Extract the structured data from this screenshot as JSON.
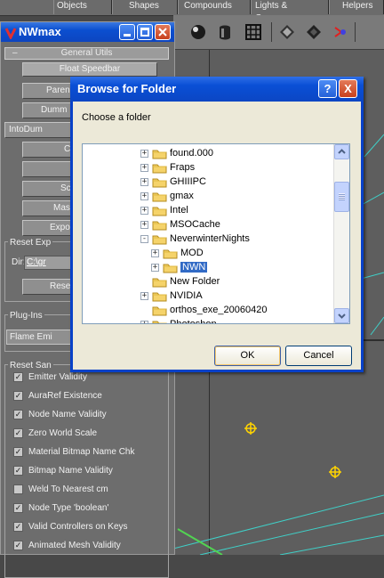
{
  "top_tabs": [
    "Objects",
    "Shapes",
    "Compounds",
    "Lights & Cameras",
    "Helpers"
  ],
  "toolbar_icons": [
    "sphere-icon",
    "cylinder-icon",
    "grid-icon",
    "diamond-icon",
    "diamond-filled-icon",
    "bone-icon"
  ],
  "nwmax": {
    "title": "NWmax",
    "rollout_general": "General Utils",
    "float_speedbar": "Float Speedbar",
    "buttons": [
      "Paren",
      "Dumm",
      "IntoDum",
      "C",
      "",
      "Sc",
      "Mas",
      "Expor"
    ],
    "reset_exp_label": "Reset Exp",
    "dir_label": "Dir:",
    "dir_value": "C:\\gr",
    "reset_button": "Reset",
    "plugins_label": "Plug-Ins",
    "plugin_value": "Flame Emi",
    "reset_san_label": "Reset San",
    "checks": [
      {
        "label": "Emitter Validity",
        "checked": true
      },
      {
        "label": "AuraRef Existence",
        "checked": true
      },
      {
        "label": "Node Name Validity",
        "checked": true
      },
      {
        "label": "Zero World Scale",
        "checked": true
      },
      {
        "label": "Material Bitmap Name Chk",
        "checked": true
      },
      {
        "label": "Bitmap Name Validity",
        "checked": true
      },
      {
        "label": "Weld To Nearest cm",
        "checked": false
      },
      {
        "label": "Node Type 'boolean'",
        "checked": true
      },
      {
        "label": "Valid Controllers on Keys",
        "checked": true
      },
      {
        "label": "Animated Mesh Validity",
        "checked": true
      }
    ]
  },
  "dialog": {
    "title": "Browse for Folder",
    "help": "?",
    "close": "X",
    "prompt": "Choose a folder",
    "tree": [
      {
        "label": "found.000",
        "level": 0,
        "exp": "+"
      },
      {
        "label": "Fraps",
        "level": 0,
        "exp": "+"
      },
      {
        "label": "GHIIIPC",
        "level": 0,
        "exp": "+"
      },
      {
        "label": "gmax",
        "level": 0,
        "exp": "+"
      },
      {
        "label": "Intel",
        "level": 0,
        "exp": "+"
      },
      {
        "label": "MSOCache",
        "level": 0,
        "exp": "+"
      },
      {
        "label": "NeverwinterNights",
        "level": 0,
        "exp": "-"
      },
      {
        "label": "MOD",
        "level": 1,
        "exp": "+"
      },
      {
        "label": "NWN",
        "level": 1,
        "exp": "+",
        "selected": true
      },
      {
        "label": "New Folder",
        "level": 0,
        "exp": ""
      },
      {
        "label": "NVIDIA",
        "level": 0,
        "exp": "+"
      },
      {
        "label": "orthos_exe_20060420",
        "level": 0,
        "exp": ""
      },
      {
        "label": "Photoshop",
        "level": 0,
        "exp": "+"
      }
    ],
    "ok": "OK",
    "cancel": "Cancel"
  }
}
